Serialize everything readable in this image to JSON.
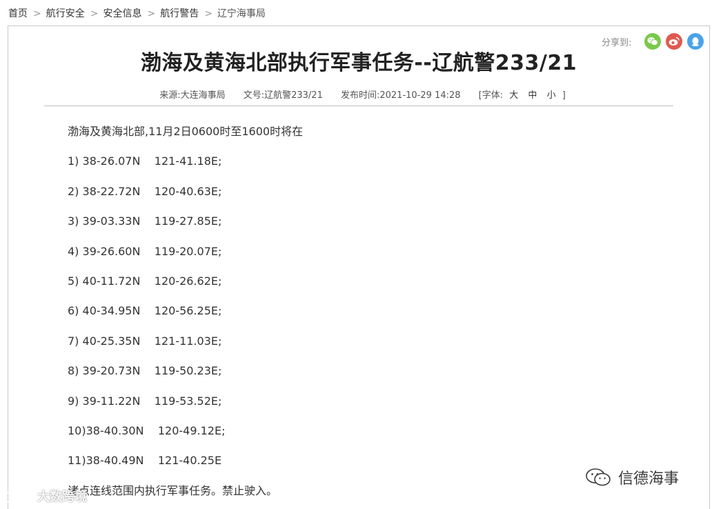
{
  "breadcrumb": {
    "items": [
      "首页",
      "航行安全",
      "安全信息",
      "航行警告",
      "辽宁海事局"
    ],
    "separator": ">"
  },
  "share": {
    "label": "分享到:",
    "icons": [
      "wechat-icon",
      "weibo-icon",
      "qq-icon"
    ]
  },
  "article": {
    "title": "渤海及黄海北部执行军事任务--辽航警233/21",
    "meta": {
      "source": "来源:大连海事局",
      "doc_no": "文号:辽航警233/21",
      "published": "发布时间:2021-10-29 14:28",
      "font_label": "[字体:",
      "font_sizes": [
        "大",
        "中",
        "小"
      ],
      "font_close": "]"
    },
    "lines": [
      "渤海及黄海北部,11月2日0600时至1600时将在",
      "1) 38-26.07N    121-41.18E;",
      "2) 38-22.72N    120-40.63E;",
      "3) 39-03.33N    119-27.85E;",
      "4) 39-26.60N    119-20.07E;",
      "5) 40-11.72N    120-26.62E;",
      "6) 40-34.95N    120-56.25E;",
      "7) 40-25.35N    121-11.03E;",
      "8) 39-20.73N    119-50.23E;",
      "9) 39-11.22N    119-53.52E;",
      "10)38-40.30N    120-49.12E;",
      "11)38-40.49N    121-40.25E",
      "诸点连线范围内执行军事任务。禁止驶入。"
    ]
  },
  "watermarks": {
    "right": "信德海事",
    "left": "大数跨境"
  },
  "colors": {
    "wechat": "#7ac94a",
    "weibo": "#e0594f",
    "qq": "#4aa3e8",
    "border": "#c8c8c8"
  }
}
